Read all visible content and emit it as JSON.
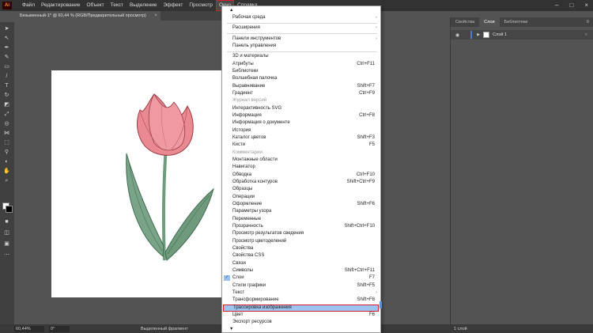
{
  "menubar": {
    "logo": "Ai",
    "items": [
      "Файл",
      "Редактирование",
      "Объект",
      "Текст",
      "Выделение",
      "Эффект",
      "Просмотр",
      "Окно",
      "Справка"
    ],
    "active_index": 7
  },
  "document": {
    "tab_title": "Безымянный-1* @ 60,44 % (RGB/Предварительный просмотр)",
    "close": "×"
  },
  "right_panel": {
    "tabs": [
      "Свойства",
      "Слои",
      "Библиотеки"
    ],
    "active_tab": 1,
    "layer_name": "Слой 1"
  },
  "statusbar": {
    "zoom": "60,44%",
    "rotation": "0°",
    "selection_mode": "Выделенный фрагмент",
    "layers_count": "1 слой"
  },
  "window_menu": {
    "items": [
      {
        "label": "Рабочая среда",
        "submenu": true
      },
      {
        "sep": true
      },
      {
        "label": "Расширения",
        "submenu": true
      },
      {
        "sep": true
      },
      {
        "label": "Панели инструментов",
        "submenu": true
      },
      {
        "label": "Панель управления"
      },
      {
        "sep": true
      },
      {
        "label": "3D и материалы"
      },
      {
        "label": "Атрибуты",
        "shortcut": "Ctrl+F11"
      },
      {
        "label": "Библиотеки"
      },
      {
        "label": "Волшебная палочка"
      },
      {
        "label": "Выравнивание",
        "shortcut": "Shift+F7"
      },
      {
        "label": "Градиент",
        "shortcut": "Ctrl+F9"
      },
      {
        "label": "Журнал версий",
        "disabled": true
      },
      {
        "label": "Интерактивность SVG"
      },
      {
        "label": "Информация",
        "shortcut": "Ctrl+F8"
      },
      {
        "label": "Информация о документе"
      },
      {
        "label": "История"
      },
      {
        "label": "Каталог цветов",
        "shortcut": "Shift+F3"
      },
      {
        "label": "Кисти",
        "shortcut": "F5"
      },
      {
        "label": "Комментарии",
        "disabled": true
      },
      {
        "label": "Монтажные области"
      },
      {
        "label": "Навигатор"
      },
      {
        "label": "Обводка",
        "shortcut": "Ctrl+F10"
      },
      {
        "label": "Обработка контуров",
        "shortcut": "Shift+Ctrl+F9"
      },
      {
        "label": "Образцы"
      },
      {
        "label": "Операции"
      },
      {
        "label": "Оформление",
        "shortcut": "Shift+F6"
      },
      {
        "label": "Параметры узора"
      },
      {
        "label": "Переменные"
      },
      {
        "label": "Прозрачность",
        "shortcut": "Shift+Ctrl+F10"
      },
      {
        "label": "Просмотр результатов сведения"
      },
      {
        "label": "Просмотр цветоделений"
      },
      {
        "label": "Свойства"
      },
      {
        "label": "Свойства CSS"
      },
      {
        "label": "Связи"
      },
      {
        "label": "Символы",
        "shortcut": "Shift+Ctrl+F11"
      },
      {
        "label": "Слои",
        "shortcut": "F7",
        "checked": true
      },
      {
        "label": "Стили графики",
        "shortcut": "Shift+F5"
      },
      {
        "label": "Текст",
        "submenu": true
      },
      {
        "label": "Трансформирование",
        "shortcut": "Shift+F8"
      },
      {
        "label": "Трассировка изображения",
        "highlight": true
      },
      {
        "label": "Цвет",
        "shortcut": "F6"
      },
      {
        "label": "Экспорт ресурсов"
      }
    ]
  },
  "colors": {
    "accent_highlight": "#9cc4ee",
    "outline_red": "#d91c2a",
    "tulip_pink": "#e67b86",
    "leaf_green": "#6f9a7c"
  }
}
